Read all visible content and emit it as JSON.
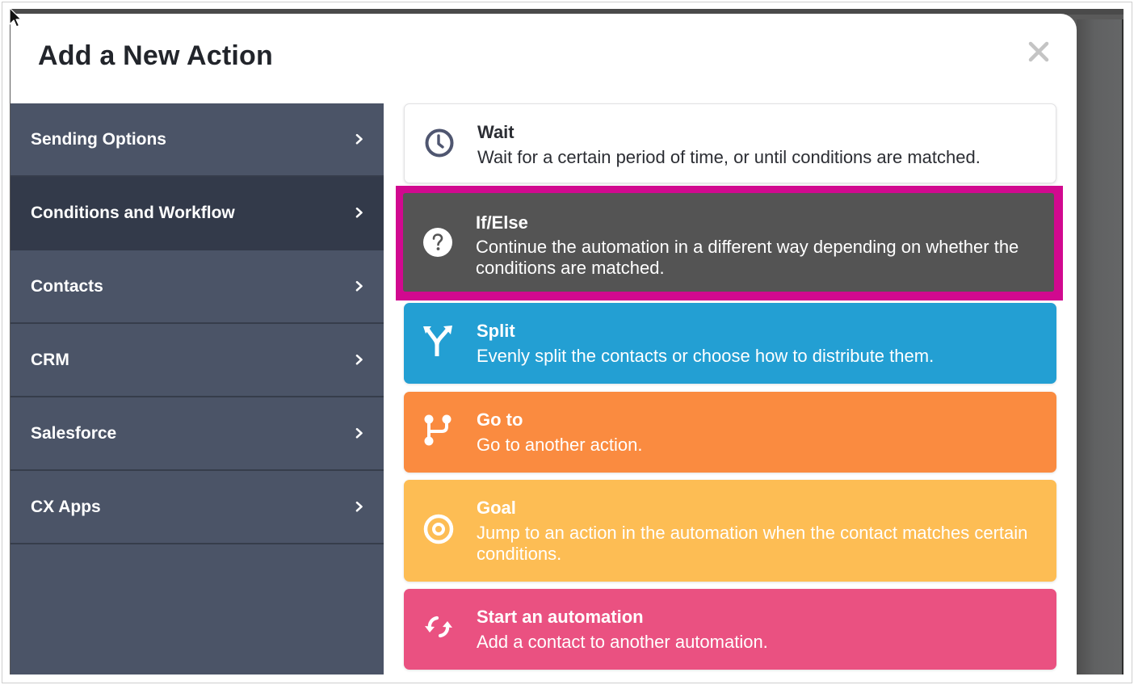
{
  "modal": {
    "title": "Add a New Action",
    "close_icon": "close-icon"
  },
  "sidebar": {
    "items": [
      {
        "label": "Sending Options",
        "icon": "chevron-right-icon",
        "active": false
      },
      {
        "label": "Conditions and Workflow",
        "icon": "chevron-right-icon",
        "active": true
      },
      {
        "label": "Contacts",
        "icon": "chevron-right-icon",
        "active": false
      },
      {
        "label": "CRM",
        "icon": "chevron-right-icon",
        "active": false
      },
      {
        "label": "Salesforce",
        "icon": "chevron-right-icon",
        "active": false
      },
      {
        "label": "CX Apps",
        "icon": "chevron-right-icon",
        "active": false
      }
    ]
  },
  "actions": [
    {
      "title": "Wait",
      "description": "Wait for a certain period of time, or until conditions are matched.",
      "icon": "clock-icon",
      "color": "#ffffff"
    },
    {
      "title": "If/Else",
      "description": "Continue the automation in a different way depending on whether the conditions are matched.",
      "icon": "question-circle-icon",
      "color": "#545454",
      "highlighted": true,
      "highlight_color": "#d1098f"
    },
    {
      "title": "Split",
      "description": "Evenly split the contacts or choose how to distribute them.",
      "icon": "split-arrows-icon",
      "color": "#239fd3"
    },
    {
      "title": "Go to",
      "description": "Go to another action.",
      "icon": "branch-icon",
      "color": "#fa8b40"
    },
    {
      "title": "Goal",
      "description": "Jump to an action in the automation when the contact matches certain conditions.",
      "icon": "target-icon",
      "color": "#fdbd54"
    },
    {
      "title": "Start an automation",
      "description": "Add a contact to another automation.",
      "icon": "refresh-arrows-icon",
      "color": "#ea5181"
    }
  ],
  "colors": {
    "sidebar_bg": "#4b5467",
    "sidebar_active_bg": "#333a4a",
    "title_text": "#22252b"
  }
}
